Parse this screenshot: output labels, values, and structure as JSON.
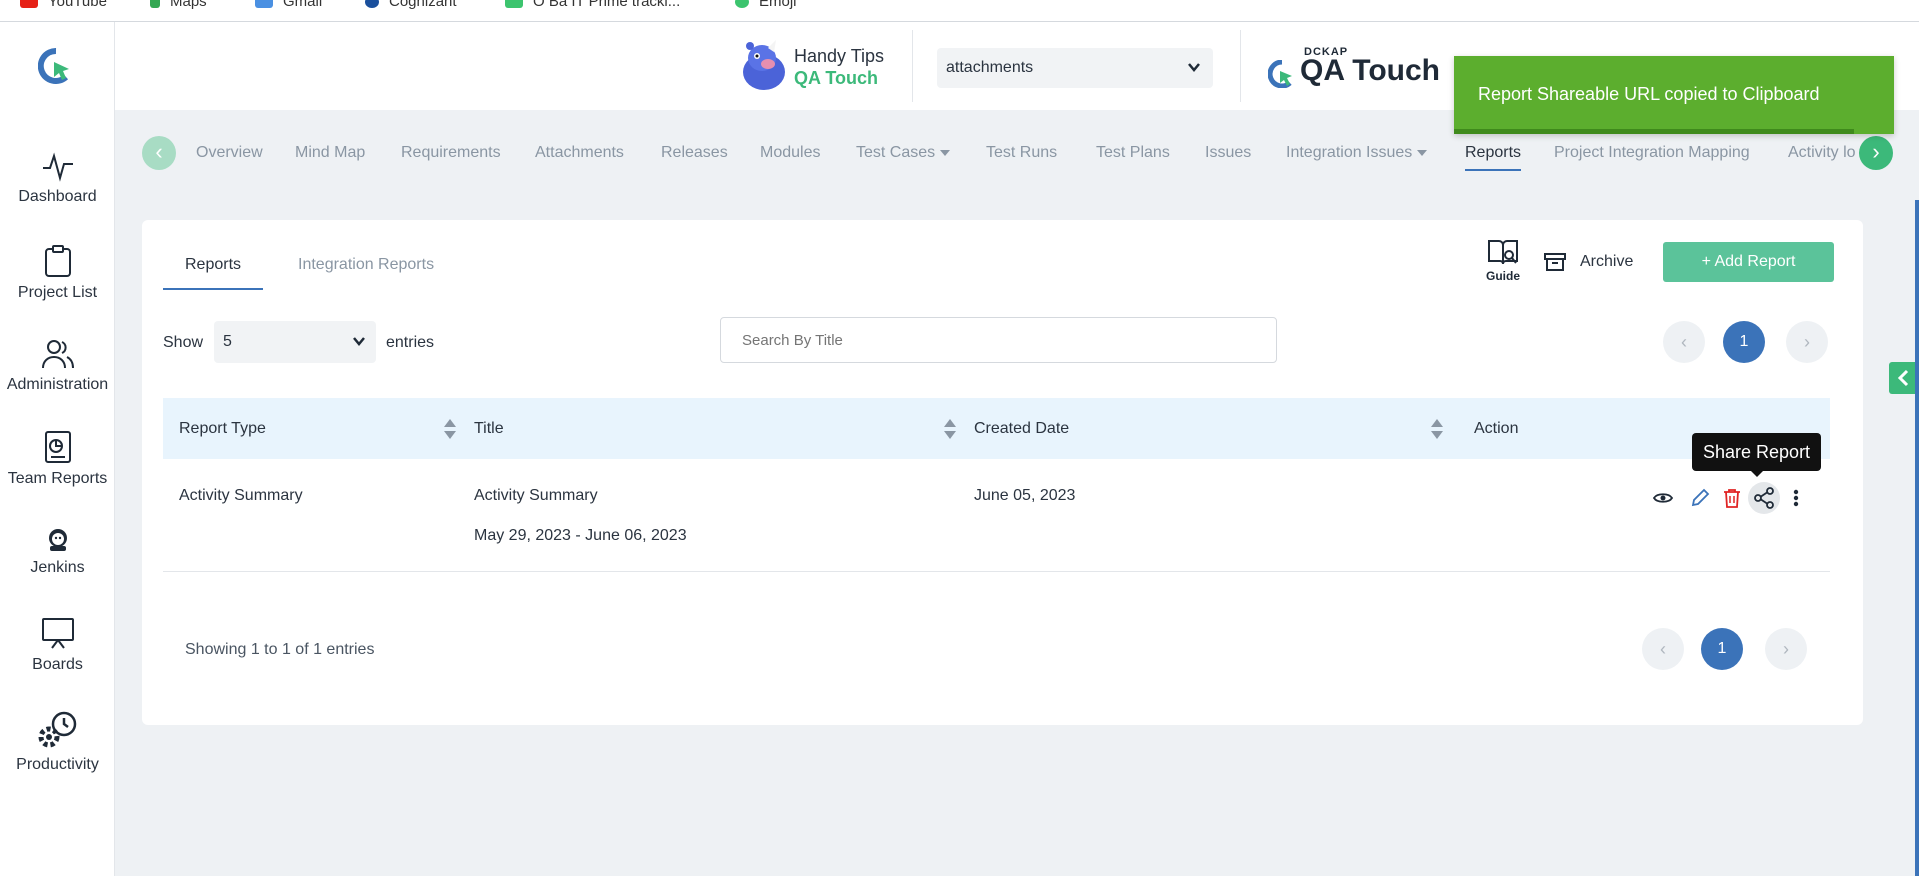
{
  "bookmarks": [
    "YouTube",
    "Maps",
    "Gmail",
    "Cognizant",
    "O Ba IT Prime tracki...",
    "Emoji"
  ],
  "sidebar": {
    "items": [
      {
        "label": "Dashboard"
      },
      {
        "label": "Project List"
      },
      {
        "label": "Administration"
      },
      {
        "label": "Team Reports"
      },
      {
        "label": "Jenkins"
      },
      {
        "label": "Boards"
      },
      {
        "label": "Productivity"
      }
    ]
  },
  "header": {
    "tips_line1": "Handy Tips",
    "tips_line2": "QA Touch",
    "project_select": "attachments",
    "brand_small": "DCKAP",
    "brand_name": "QA Touch"
  },
  "toast": {
    "message": "Report Shareable URL copied to Clipboard"
  },
  "tabs": [
    {
      "label": "Overview"
    },
    {
      "label": "Mind Map"
    },
    {
      "label": "Requirements"
    },
    {
      "label": "Attachments"
    },
    {
      "label": "Releases"
    },
    {
      "label": "Modules"
    },
    {
      "label": "Test Cases"
    },
    {
      "label": "Test Runs"
    },
    {
      "label": "Test Plans"
    },
    {
      "label": "Issues"
    },
    {
      "label": "Integration Issues"
    },
    {
      "label": "Reports"
    },
    {
      "label": "Project Integration Mapping"
    },
    {
      "label": "Activity lo"
    }
  ],
  "tabs_nav": {
    "prev": "‹",
    "next": "›"
  },
  "reports": {
    "subtabs": [
      {
        "label": "Reports"
      },
      {
        "label": "Integration Reports"
      }
    ],
    "guide_label": "Guide",
    "archive_label": "Archive",
    "add_label": "+ Add Report",
    "show_label": "Show",
    "entries_value": "5",
    "entries_label": "entries",
    "search_placeholder": "Search By Title",
    "pager": {
      "prev": "‹",
      "current": "1",
      "next": "›"
    },
    "columns": [
      "Report Type",
      "Title",
      "Created Date",
      "Action"
    ],
    "rows": [
      {
        "report_type": "Activity Summary",
        "title": "Activity Summary",
        "date_range": "May 29, 2023 - June 06, 2023",
        "created": "June 05, 2023"
      }
    ],
    "tooltip": "Share Report",
    "showing": "Showing 1 to 1 of 1 entries"
  },
  "colors": {
    "accent": "#3b73b9",
    "green": "#5bc39a",
    "toast": "#5cae2e"
  }
}
